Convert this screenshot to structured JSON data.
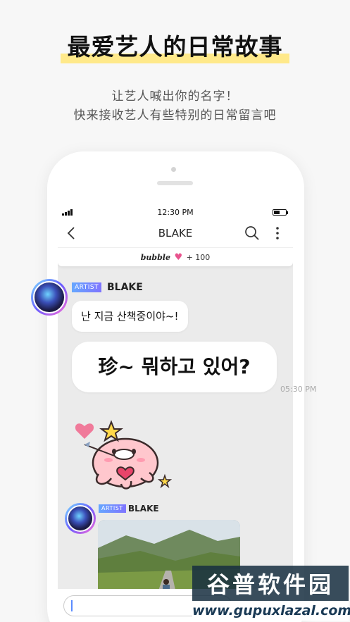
{
  "promo": {
    "headline": "最爱艺人的日常故事",
    "subline1": "让艺人喊出你的名字！",
    "subline2": "快来接收艺人有些特别的日常留言吧"
  },
  "status_bar": {
    "time": "12:30 PM"
  },
  "nav": {
    "title": "BLAKE",
    "back_icon": "chevron-left-icon",
    "search_icon": "search-icon",
    "more_icon": "more-vertical-icon"
  },
  "bubble_bar": {
    "logo": "bubble",
    "heart_icon": "heart-icon",
    "count": "+ 100"
  },
  "chat": {
    "messages": [
      {
        "badge": "ARTIST",
        "sender": "BLAKE",
        "text": "난 지금 산책중이야~!"
      },
      {
        "text": "珍~ 뭐하고 있어?",
        "time": "05:30 PM"
      },
      {
        "sticker": "pink-octopus-heart-sticker"
      },
      {
        "badge": "ARTIST",
        "sender": "BLAKE",
        "image": "mountain-road-photo"
      }
    ]
  },
  "watermark": {
    "name": "谷普软件园",
    "url": "www.gupuxlazal.com"
  },
  "colors": {
    "highlight": "#ffe98a",
    "badge": "#7a8cff",
    "heart": "#e8548e",
    "chat_bg": "#ebebeb"
  }
}
